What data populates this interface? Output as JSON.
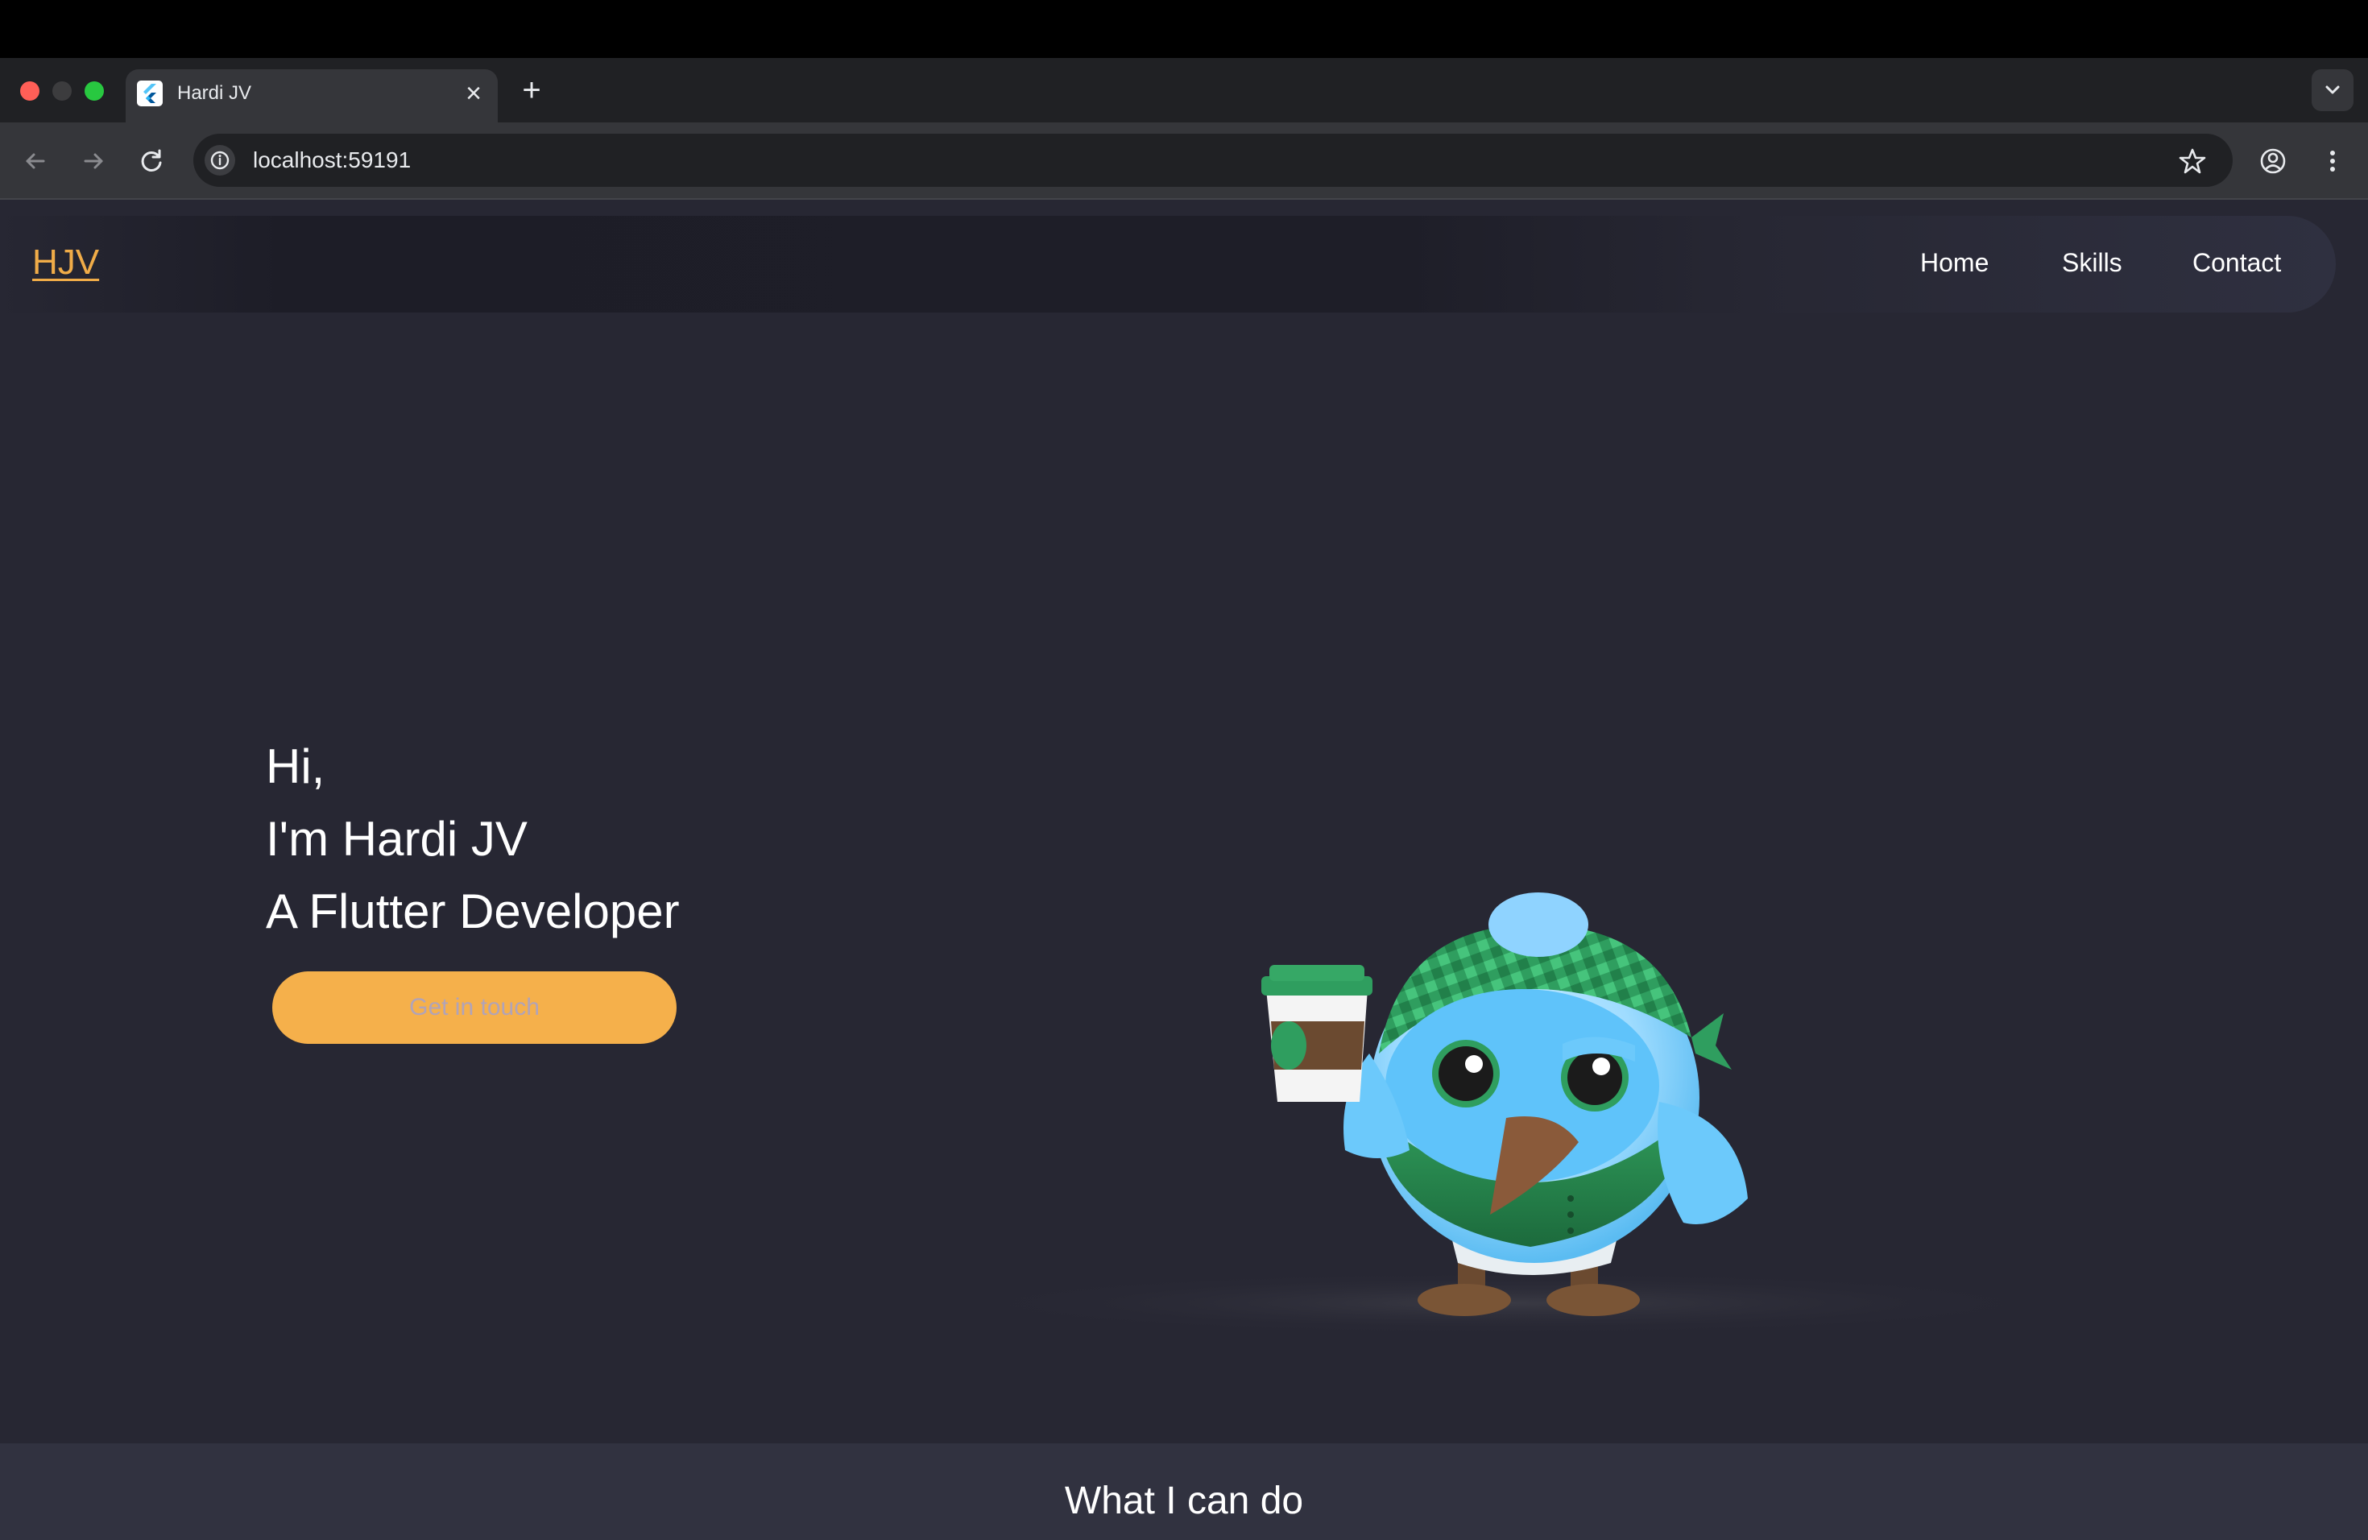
{
  "browser": {
    "tab_title": "Hardi JV",
    "new_tab_symbol": "+",
    "close_symbol": "×",
    "url": "localhost:59191",
    "icons": [
      "back-arrow-icon",
      "forward-arrow-icon",
      "reload-icon",
      "info-icon",
      "star-icon",
      "profile-icon",
      "more-icon",
      "chevron-down-icon",
      "flutter-icon"
    ]
  },
  "navbar": {
    "logo": "HJV",
    "links": [
      "Home",
      "Skills",
      "Contact"
    ]
  },
  "hero": {
    "greeting": "Hi,",
    "name_line": "I'm Hardi JV",
    "role_line": "A Flutter Developer",
    "cta_label": "Get in touch"
  },
  "skills_section": {
    "title": "What I can do"
  },
  "colors": {
    "accent": "#f5b04b",
    "logo": "#f0ac48",
    "page_bg": "#272733",
    "section_bg": "#313240",
    "cta_text": "#b0a3b9"
  }
}
